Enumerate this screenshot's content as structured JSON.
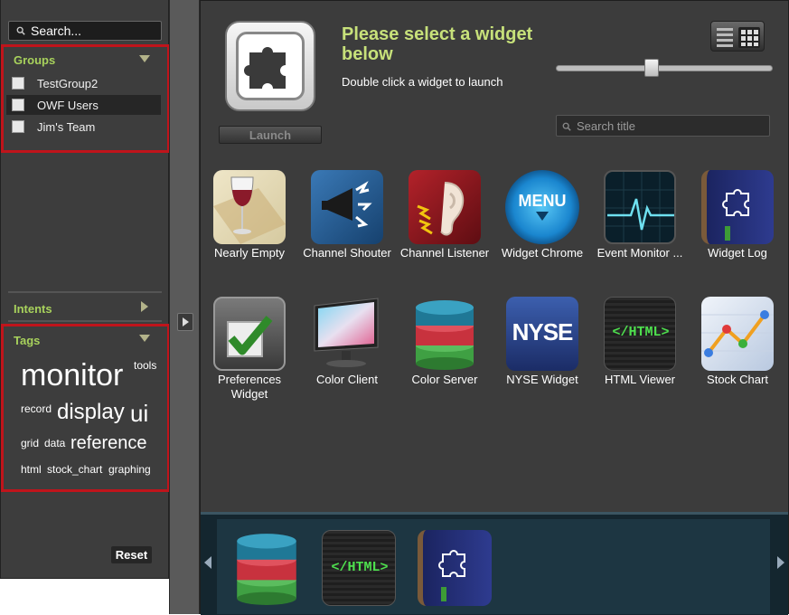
{
  "sidebar": {
    "search_placeholder": "Search...",
    "groups_header": "Groups",
    "groups": [
      {
        "label": "TestGroup2",
        "selected": false
      },
      {
        "label": "OWF Users",
        "selected": true
      },
      {
        "label": "Jim's Team",
        "selected": false
      }
    ],
    "intents_header": "Intents",
    "tags_header": "Tags",
    "tags": [
      "monitor",
      "tools",
      "record",
      "display",
      "ui",
      "grid",
      "data",
      "reference",
      "html",
      "stock_chart",
      "graphing"
    ],
    "reset_label": "Reset"
  },
  "main": {
    "launch_label": "Launch",
    "title": "Please select a widget below",
    "subtitle": "Double click a widget to launch",
    "zoom_slider_value": 0.45,
    "title_search_placeholder": "Search title",
    "widgets": [
      {
        "label": "Nearly Empty"
      },
      {
        "label": "Channel Shouter"
      },
      {
        "label": "Channel Listener"
      },
      {
        "label": "Widget Chrome",
        "icon_text": "MENU"
      },
      {
        "label": "Event Monitor ..."
      },
      {
        "label": "Widget Log"
      },
      {
        "label": "Preferences Widget"
      },
      {
        "label": "Color Client"
      },
      {
        "label": "Color Server"
      },
      {
        "label": "NYSE Widget",
        "icon_text": "NYSE"
      },
      {
        "label": "HTML Viewer",
        "icon_text": "</HTML>"
      },
      {
        "label": "Stock Chart"
      }
    ]
  },
  "dock": {
    "items": [
      {
        "name": "Color Server"
      },
      {
        "name": "HTML Viewer",
        "icon_text": "</HTML>"
      },
      {
        "name": "Widget Log"
      }
    ]
  },
  "colors": {
    "accent_green": "#a8d25c",
    "title_green": "#c7e17a",
    "highlight_red": "#c0141b"
  }
}
